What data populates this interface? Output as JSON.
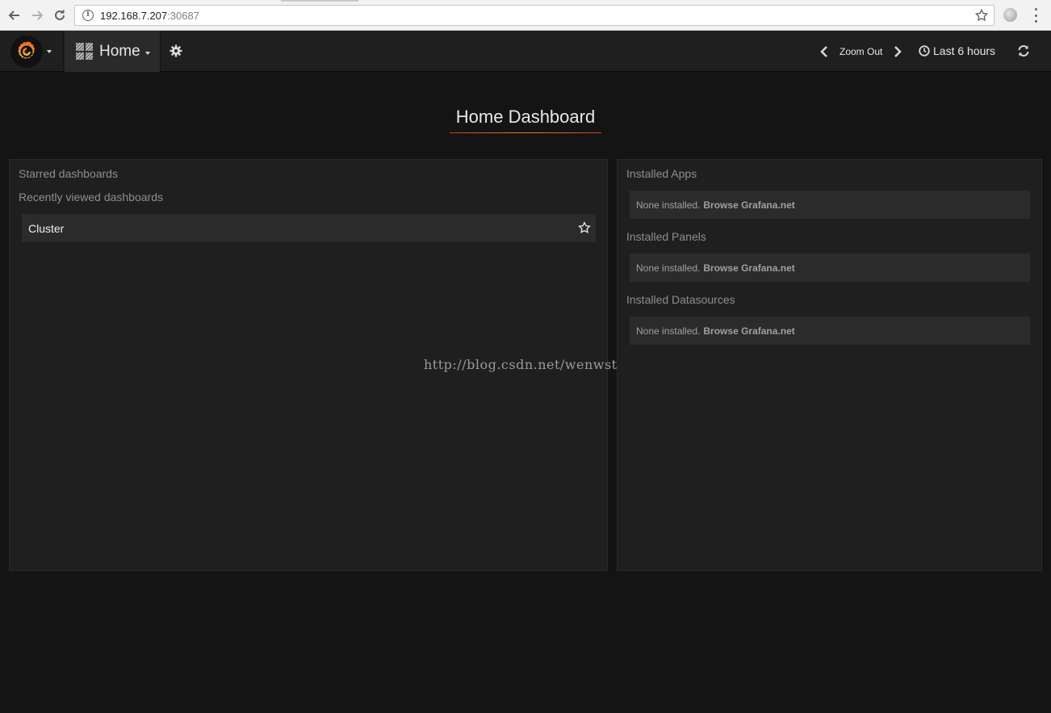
{
  "browser": {
    "url_host": "192.168.7.207",
    "url_port": ":30687"
  },
  "navbar": {
    "home_label": "Home",
    "zoom_label": "Zoom Out",
    "time_range": "Last 6 hours"
  },
  "dashboard": {
    "title": "Home Dashboard"
  },
  "left_panel": {
    "starred_heading": "Starred dashboards",
    "recent_heading": "Recently viewed dashboards",
    "recent_items": [
      {
        "label": "Cluster"
      }
    ]
  },
  "right_panel": {
    "sections": [
      {
        "heading": "Installed Apps",
        "empty_text": "None installed.",
        "link_text": "Browse Grafana.net"
      },
      {
        "heading": "Installed Panels",
        "empty_text": "None installed.",
        "link_text": "Browse Grafana.net"
      },
      {
        "heading": "Installed Datasources",
        "empty_text": "None installed.",
        "link_text": "Browse Grafana.net"
      }
    ]
  },
  "watermark": "http://blog.csdn.net/wenwst",
  "colors": {
    "background": "#141414",
    "panel": "#1f1f20",
    "accent": "#e6801f"
  }
}
